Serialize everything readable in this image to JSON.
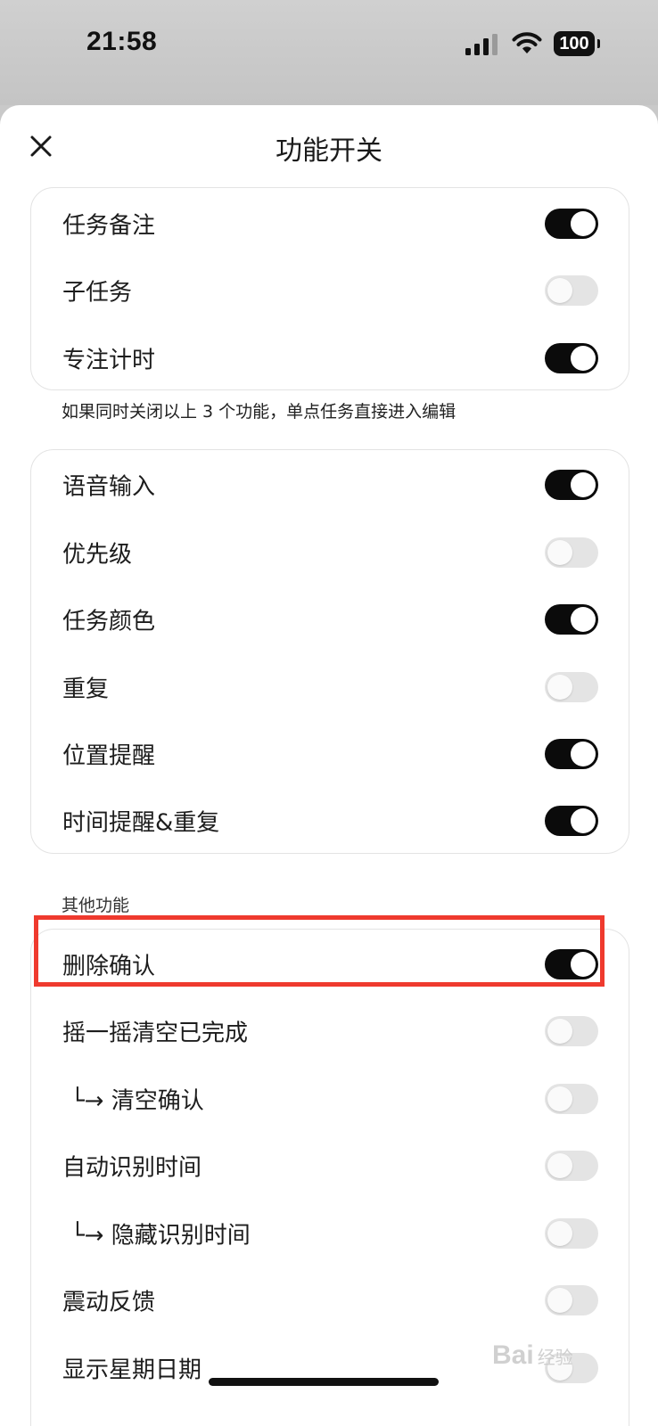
{
  "status_bar": {
    "time": "21:58",
    "battery": "100",
    "icons": [
      "cellular-signal-icon",
      "wifi-icon",
      "battery-icon"
    ]
  },
  "header": {
    "title": "功能开关",
    "close_icon": "close-icon"
  },
  "group1": {
    "items": [
      {
        "label": "任务备注",
        "on": true
      },
      {
        "label": "子任务",
        "on": false
      },
      {
        "label": "专注计时",
        "on": true
      }
    ],
    "note": "如果同时关闭以上 3 个功能，单点任务直接进入编辑"
  },
  "group2": {
    "items": [
      {
        "label": "语音输入",
        "on": true
      },
      {
        "label": "优先级",
        "on": false
      },
      {
        "label": "任务颜色",
        "on": true
      },
      {
        "label": "重复",
        "on": false
      },
      {
        "label": "位置提醒",
        "on": true
      },
      {
        "label": "时间提醒&重复",
        "on": true
      }
    ]
  },
  "group3": {
    "section_title": "其他功能",
    "items": [
      {
        "label": "删除确认",
        "on": true
      },
      {
        "label": "摇一摇清空已完成",
        "on": false
      },
      {
        "label": "└→ 清空确认",
        "on": false
      },
      {
        "label": "自动识别时间",
        "on": false
      },
      {
        "label": "└→ 隐藏识别时间",
        "on": false
      },
      {
        "label": "震动反馈",
        "on": false
      },
      {
        "label": "显示星期日期",
        "on": false
      }
    ]
  },
  "colors": {
    "toggle_on": "#0b0b0b",
    "toggle_off": "#e4e4e4",
    "highlight_border": "#ef3a2e"
  },
  "watermark": {
    "text": "Bai",
    "sub": "经验"
  }
}
